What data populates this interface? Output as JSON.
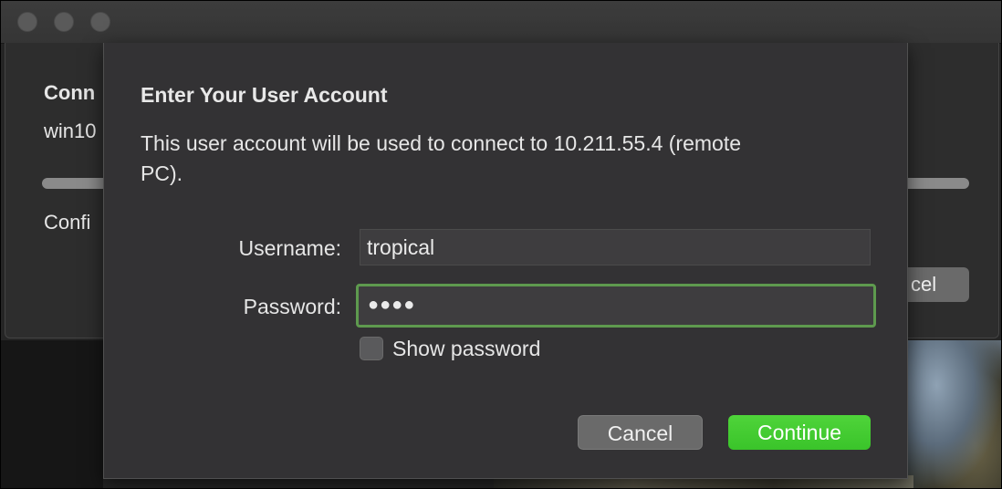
{
  "background_window": {
    "title_partial": "Conn",
    "host_partial": "win10",
    "status_partial": "Confi",
    "cancel_partial": "cel"
  },
  "dialog": {
    "title": "Enter Your User Account",
    "message": "This user account will be used to connect to 10.211.55.4 (remote PC).",
    "username_label": "Username:",
    "username_value": "tropical",
    "password_label": "Password:",
    "password_value": "●●●●",
    "show_password_label": "Show password",
    "show_password_checked": false,
    "cancel_label": "Cancel",
    "continue_label": "Continue"
  },
  "colors": {
    "accent_focus": "#5e9a4e",
    "primary_button": "#3ac42a"
  }
}
